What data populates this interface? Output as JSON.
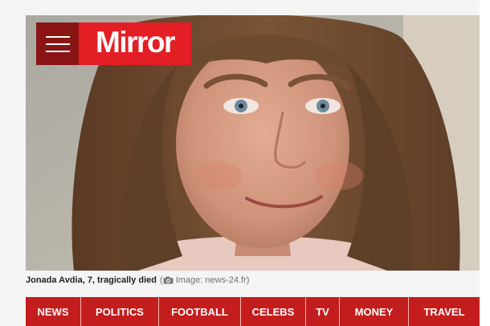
{
  "brand": {
    "logo_text": "Mirror",
    "menu_icon": "hamburger-menu-icon",
    "colors": {
      "brand_red": "#e31e24",
      "menu_dark_red": "#8b1414",
      "nav_red": "#c41d1d"
    }
  },
  "article": {
    "caption_text": "Jonada Avdia, 7, tragically died",
    "credit_icon": "camera-icon",
    "credit_text": "Image: news-24.fr"
  },
  "nav": {
    "items": [
      {
        "label": "NEWS"
      },
      {
        "label": "POLITICS"
      },
      {
        "label": "FOOTBALL"
      },
      {
        "label": "CELEBS"
      },
      {
        "label": "TV"
      },
      {
        "label": "MONEY"
      },
      {
        "label": "TRAVEL"
      }
    ]
  }
}
